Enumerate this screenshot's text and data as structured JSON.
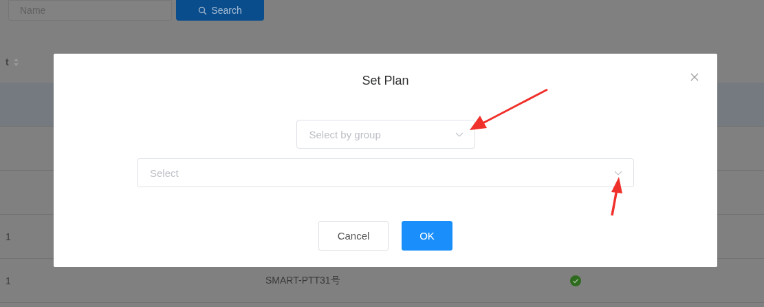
{
  "toolbar": {
    "name_field": {
      "placeholder": "Name"
    },
    "search_button": {
      "label": "Search"
    }
  },
  "table": {
    "column_1_header": "t",
    "rows": [
      {},
      {},
      {},
      {
        "column_1": "1"
      },
      {
        "column_1": "1",
        "name": "SMART-PTT31号",
        "online": true
      }
    ]
  },
  "dialog": {
    "title": "Set Plan",
    "group_select": {
      "placeholder": "Select by group"
    },
    "plan_select": {
      "placeholder": "Select"
    },
    "buttons": [
      {
        "label": "Cancel",
        "kind": "default"
      },
      {
        "label": "OK",
        "kind": "primary"
      }
    ]
  }
}
